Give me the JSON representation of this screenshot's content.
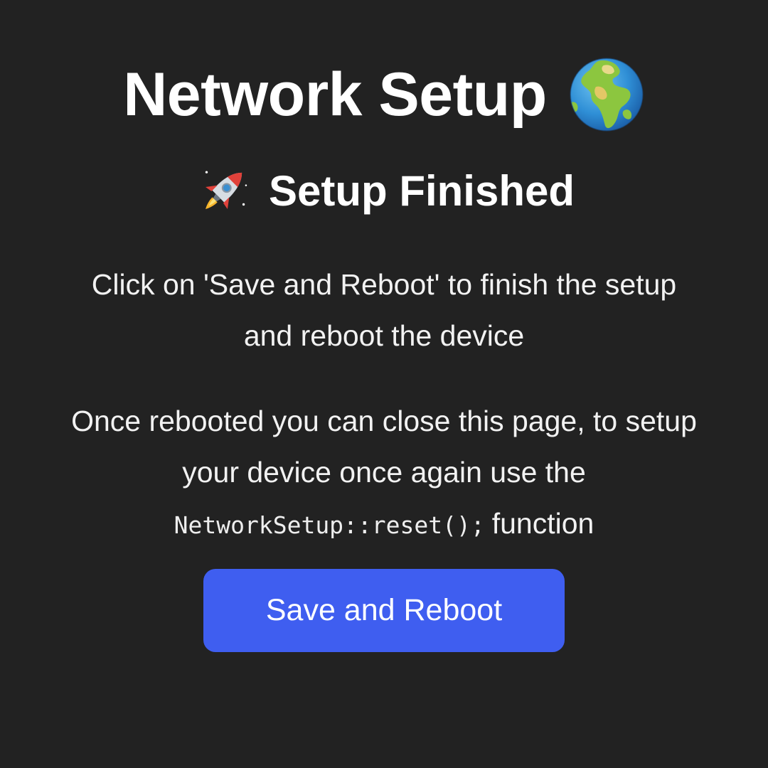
{
  "header": {
    "title": "Network Setup",
    "title_icon": "globe-icon",
    "subtitle": "Setup Finished",
    "subtitle_icon": "rocket-icon"
  },
  "content": {
    "instruction_line1": "Click on 'Save and Reboot' to finish the setup",
    "instruction_line2": "and reboot the device",
    "info_line1": "Once rebooted you can close this page, to setup",
    "info_line2": "your device once again use the",
    "info_code": "NetworkSetup::reset();",
    "info_suffix": "function"
  },
  "actions": {
    "save_reboot_label": "Save and Reboot"
  },
  "colors": {
    "background": "#222222",
    "text": "#ffffff",
    "button": "#3f5ef0"
  }
}
